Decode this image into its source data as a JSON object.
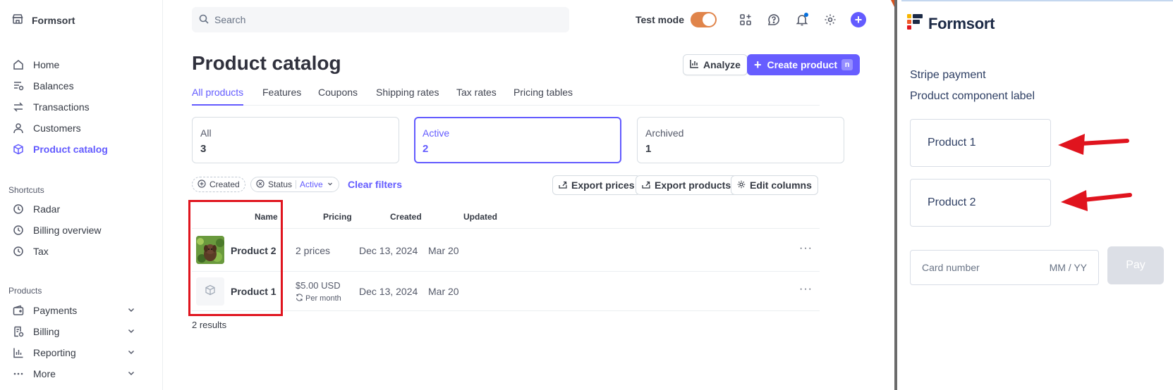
{
  "sidebar": {
    "brand": "Formsort",
    "nav": [
      {
        "label": "Home",
        "icon": "home-icon"
      },
      {
        "label": "Balances",
        "icon": "balances-icon"
      },
      {
        "label": "Transactions",
        "icon": "transactions-icon"
      },
      {
        "label": "Customers",
        "icon": "person-icon"
      },
      {
        "label": "Product catalog",
        "icon": "box-icon",
        "active": true
      }
    ],
    "shortcuts_heading": "Shortcuts",
    "shortcuts": [
      {
        "label": "Radar",
        "icon": "clock-icon"
      },
      {
        "label": "Billing overview",
        "icon": "clock-icon"
      },
      {
        "label": "Tax",
        "icon": "clock-icon"
      }
    ],
    "products_heading": "Products",
    "products": [
      {
        "label": "Payments",
        "icon": "wallet-icon"
      },
      {
        "label": "Billing",
        "icon": "billing-icon"
      },
      {
        "label": "Reporting",
        "icon": "chart-icon"
      },
      {
        "label": "More",
        "icon": "more-icon"
      }
    ]
  },
  "header": {
    "search_placeholder": "Search",
    "test_mode_label": "Test mode",
    "test_mode_on": true,
    "icons": [
      "apps-icon",
      "help-icon",
      "bell-icon",
      "gear-icon",
      "plus-icon"
    ]
  },
  "page": {
    "title": "Product catalog",
    "analyze_label": "Analyze",
    "create_label": "Create product",
    "create_shortcut": "n",
    "tabs": [
      "All products",
      "Features",
      "Coupons",
      "Shipping rates",
      "Tax rates",
      "Pricing tables"
    ],
    "active_tab": "All products",
    "status_cards": [
      {
        "label": "All",
        "count": "3"
      },
      {
        "label": "Active",
        "count": "2"
      },
      {
        "label": "Archived",
        "count": "1"
      }
    ],
    "filters": {
      "created_label": "Created",
      "status_label": "Status",
      "status_value": "Active",
      "clear_label": "Clear filters"
    },
    "actions": {
      "export_prices": "Export prices",
      "export_products": "Export products",
      "edit_columns": "Edit columns"
    },
    "table": {
      "columns": [
        "Name",
        "Pricing",
        "Created",
        "Updated"
      ],
      "rows": [
        {
          "name": "Product 2",
          "pricing": "2 prices",
          "pricing_sub": "",
          "created": "Dec 13, 2024",
          "updated": "Mar 20"
        },
        {
          "name": "Product 1",
          "pricing": "$5.00 USD",
          "pricing_sub": "Per month",
          "created": "Dec 13, 2024",
          "updated": "Mar 20"
        }
      ]
    },
    "results": "2 results"
  },
  "formsort": {
    "brand": "Formsort",
    "title": "Stripe payment",
    "component_label": "Product component label",
    "choices": [
      "Product 1",
      "Product 2"
    ],
    "card_placeholder": "Card number",
    "expiry_placeholder": "MM / YY",
    "pay_label": "Pay"
  },
  "colors": {
    "accent": "#635bff",
    "highlight": "#e0141e",
    "toggle": "#e0844a",
    "formsort_text": "#2d3e63"
  }
}
